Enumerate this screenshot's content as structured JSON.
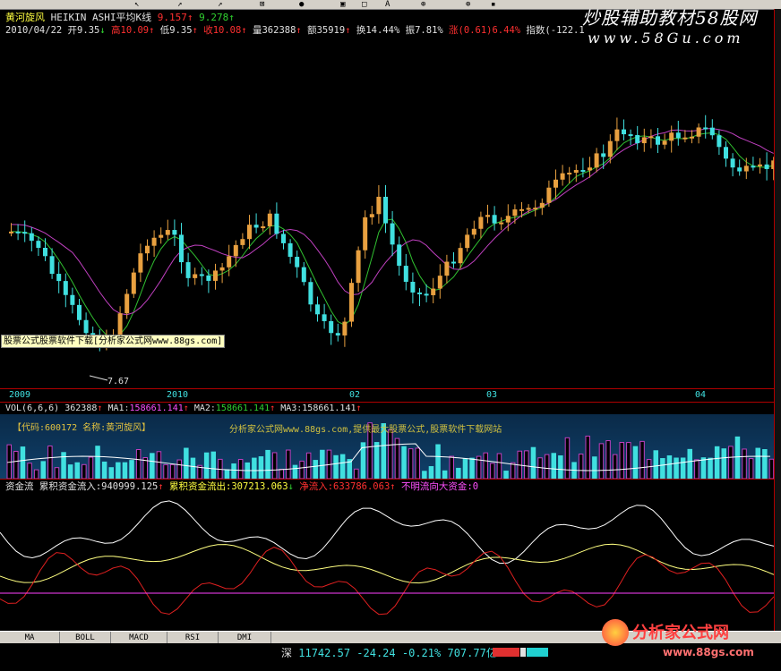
{
  "header": {
    "indicator_name": "黄河旋风",
    "chart_type": "HEIKIN ASHI平均K线",
    "val1": "9.157",
    "val1_arrow": "↑",
    "val2": "9.278",
    "val2_arrow": "↑",
    "date": "2010/04/22",
    "open_label": "开",
    "open": "9.35",
    "open_arrow": "↓",
    "high_label": "高",
    "high": "10.09",
    "high_arrow": "↑",
    "low_label": "低",
    "low": "9.35",
    "low_arrow": "↑",
    "close_label": "收",
    "close": "10.08",
    "close_arrow": "↑",
    "vol_label": "量",
    "vol": "362388",
    "vol_arrow": "↑",
    "amt_label": "额",
    "amt": "35919",
    "amt_arrow": "↑",
    "turnover_label": "换",
    "turnover": "14.44%",
    "amp_label": "振",
    "amp": "7.81%",
    "chg_label": "涨",
    "chg": "(0.61)",
    "chg_pct": "6.44%",
    "index_label": "指数",
    "index": "(-122.1"
  },
  "watermark_top": {
    "line1": "炒股辅助教材58股网",
    "line2": "www.58Gu.com"
  },
  "main_chart": {
    "promo_box": "股票公式股票软件下载[分析家公式网www.88gs.com]",
    "low_label": "7.67",
    "date_axis": [
      "2009",
      "2010",
      "02",
      "03",
      "04"
    ]
  },
  "vol_panel": {
    "title": "VOL(6,6,6)",
    "vol": "362388",
    "vol_arrow": "↑",
    "ma1_label": "MA1",
    "ma1": "158661.141",
    "ma1_arrow": "↑",
    "ma2_label": "MA2",
    "ma2": "158661.141",
    "ma2_arrow": "↑",
    "ma3_label": "MA3",
    "ma3": "158661.141",
    "ma3_arrow": "↑",
    "code_line": "【代码:600172 名称:黄河旋风】",
    "promo_line": "分析家公式网www.88gs.com,提供最大股票公式,股票软件下载网站"
  },
  "flow_panel": {
    "title": "资金流",
    "inflow_label": "累积资金流入",
    "inflow": ":940999.125",
    "inflow_arrow": "↑",
    "outflow_label": "累积资金流出",
    "outflow": ":307213.063",
    "outflow_arrow": "↓",
    "net_label": "净流入",
    "net": ":633786.063",
    "net_arrow": "↑",
    "unknown_label": "不明流向大资金",
    "unknown": ":0"
  },
  "tabs": [
    "MA",
    "BOLL",
    "MACD",
    "RSI",
    "DMI"
  ],
  "status": {
    "market": "深",
    "index": "11742.57",
    "change": "-24.24",
    "pct": "-0.21%",
    "amount": "707.77亿"
  },
  "watermark_bottom": {
    "line1": "分析家公式网",
    "line2": "www.88gs.com"
  },
  "colors": {
    "candle_up": "#e8a040",
    "candle_down": "#40e0e0",
    "ma_fast": "#30c030",
    "ma_slow": "#c040c0",
    "grid_red": "#b00000",
    "flow_white": "#ffffff",
    "flow_yellow": "#ffff80",
    "flow_red": "#e02020",
    "flow_magenta": "#ff40ff"
  }
}
